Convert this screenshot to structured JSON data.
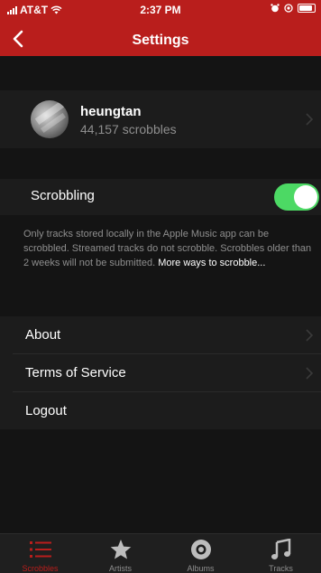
{
  "status_bar": {
    "carrier": "AT&T",
    "time": "2:37 PM"
  },
  "nav": {
    "title": "Settings",
    "back_icon": "chevron-left-icon"
  },
  "profile": {
    "username": "heungtan",
    "scrobbles": "44,157 scrobbles"
  },
  "scrobbling": {
    "label": "Scrobbling",
    "enabled": true,
    "info_text": "Only tracks stored locally in the Apple Music app can be scrobbled. Streamed tracks do not scrobble. Scrobbles older than 2 weeks will not be submitted.",
    "info_link": "More ways to scrobble..."
  },
  "menu": {
    "about": "About",
    "terms": "Terms of Service",
    "logout": "Logout"
  },
  "tabs": [
    {
      "label": "Scrobbles",
      "icon": "list-icon",
      "active": true
    },
    {
      "label": "Artists",
      "icon": "star-icon",
      "active": false
    },
    {
      "label": "Albums",
      "icon": "disc-icon",
      "active": false
    },
    {
      "label": "Tracks",
      "icon": "music-note-icon",
      "active": false
    }
  ],
  "colors": {
    "accent": "#b91e1c",
    "toggle_on": "#4cd964",
    "background": "#1c1c1c"
  }
}
